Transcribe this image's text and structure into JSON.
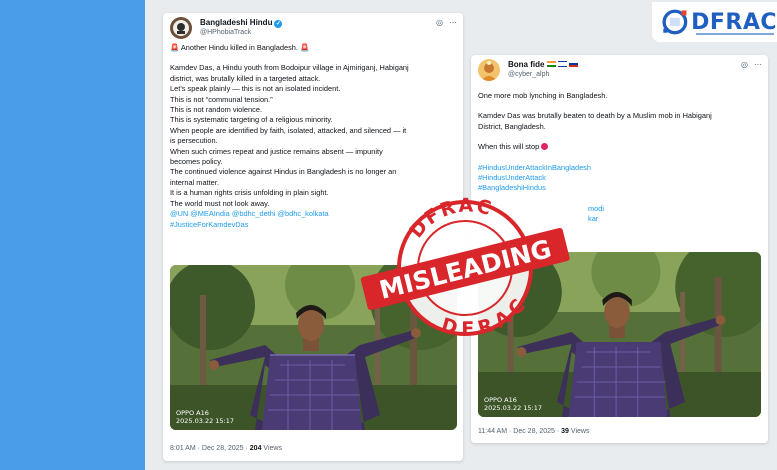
{
  "logo": {
    "text": "DFRAC"
  },
  "tweet1": {
    "name": "Bangladeshi Hindu",
    "handle": "@HPhobiaTrack",
    "lines": [
      "Another Hindu killed in Bangladesh.",
      "",
      "Kamdev Das, a Hindu youth from Bodoipur village in Ajmiriganj, Habiganj",
      "district, was brutally killed in a targeted attack.",
      "Let’s speak plainly — this is not an isolated incident.",
      "This is not “communal tension.”",
      "This is not random violence.",
      "This is systematic targeting of a religious minority.",
      "When people are identified by faith, isolated, attacked, and silenced — it",
      "is persecution.",
      "When such crimes repeat and justice remains absent — impunity",
      "becomes policy.",
      "The continued violence against Hindus in Bangladesh is no longer an",
      "internal matter.",
      "It is a human rights crisis unfolding in plain sight.",
      "The world must not look away."
    ],
    "mentions": "@UN @MEAIndia @bdhc_dethi @bdhc_kolkata",
    "hashtag": "#JusticeForKamdevDas",
    "cam_model": "OPPO A16",
    "cam_date": "2025.03.22 15:17",
    "time": "8:01 AM · Dec 28, 2025 ·",
    "views_count": "204",
    "views_label": "Views"
  },
  "tweet2": {
    "name": "Bona fide",
    "handle": "@cyber_alph",
    "line1": "One more mob lynching in Bangladesh.",
    "line2a": "Kamdev Das was brutally beaten to death by a Muslim mob in Habiganj",
    "line2b": "District, Bangladesh.",
    "line3": "When this will stop",
    "hashtags": [
      "#HindusUnderAttackInBangladesh",
      "#HindusUnderAttack",
      "#BangladeshiHindus"
    ],
    "mention_a": "modi",
    "mention_b": "kar",
    "cam_model": "OPPO A16",
    "cam_date": "2025.03.22 15:17",
    "time": "11:44 AM · Dec 28, 2025 ·",
    "views_count": "39",
    "views_label": "Views"
  },
  "stamp": {
    "label": "MISLEADING",
    "ring_top": "DFRAC",
    "ring_bottom": "DFRAC"
  },
  "colors": {
    "link": "#1d9bf0",
    "stamp_red": "#d9262b",
    "background": "#4a9ee9"
  }
}
